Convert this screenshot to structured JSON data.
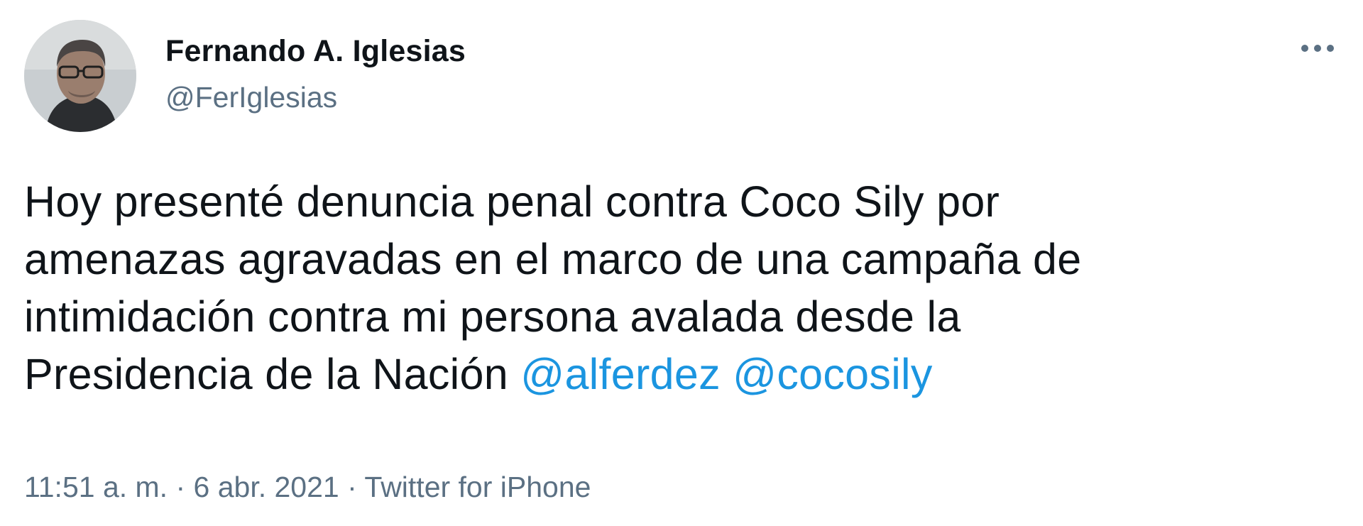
{
  "author": {
    "display_name": "Fernando A. Iglesias",
    "handle": "@FerIglesias",
    "avatar_icon": "profile-photo"
  },
  "tweet": {
    "lines": [
      "Hoy presenté denuncia penal contra Coco Sily por",
      "amenazas agravadas en el marco de una campaña de",
      "intimidación contra mi persona avalada desde la",
      "Presidencia de la Nación "
    ],
    "mentions": [
      "@alferdez",
      "@cocosily"
    ]
  },
  "meta": {
    "time": "11:51 a. m.",
    "separator": " · ",
    "date": "6 abr. 2021",
    "source": "Twitter for iPhone"
  },
  "icons": {
    "more": "more-horizontal-icon"
  },
  "colors": {
    "text": "#0f1419",
    "secondary": "#5b7083",
    "link": "#1b95e0",
    "background": "#ffffff"
  }
}
